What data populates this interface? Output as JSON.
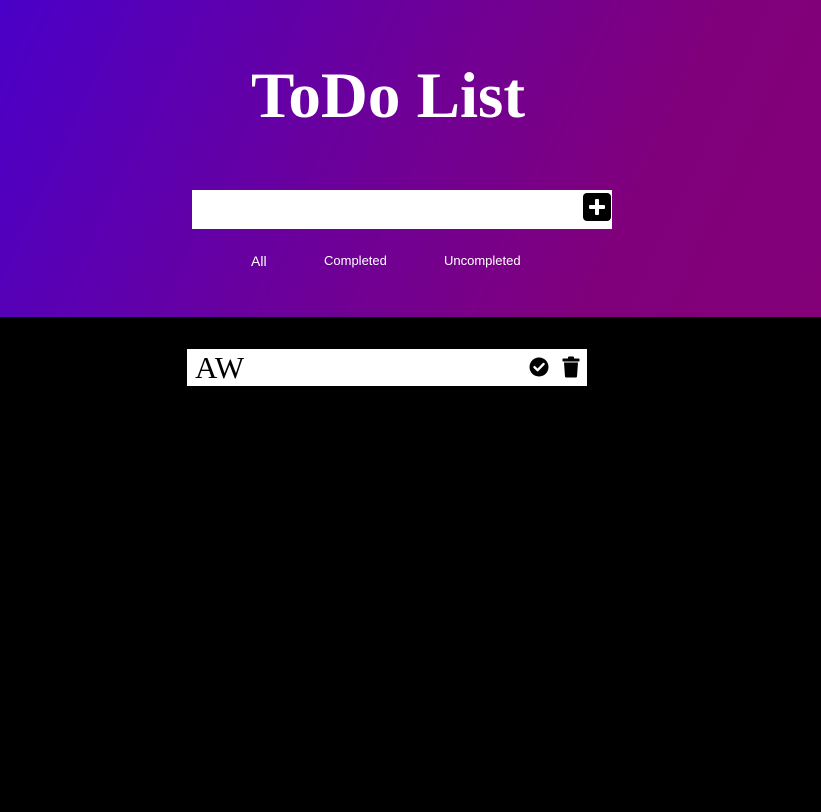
{
  "header": {
    "title": "ToDo List"
  },
  "new_todo": {
    "value": "",
    "placeholder": "",
    "add_icon": "plus-icon"
  },
  "filters": [
    {
      "label": "All"
    },
    {
      "label": "Completed"
    },
    {
      "label": "Uncompleted"
    }
  ],
  "todos": [
    {
      "text": "AW",
      "complete_icon": "check-circle-icon",
      "delete_icon": "trash-icon"
    }
  ],
  "colors": {
    "gradient_start": "#4a00c8",
    "gradient_end": "#830078",
    "background": "#000000",
    "item_background": "#ffffff"
  }
}
